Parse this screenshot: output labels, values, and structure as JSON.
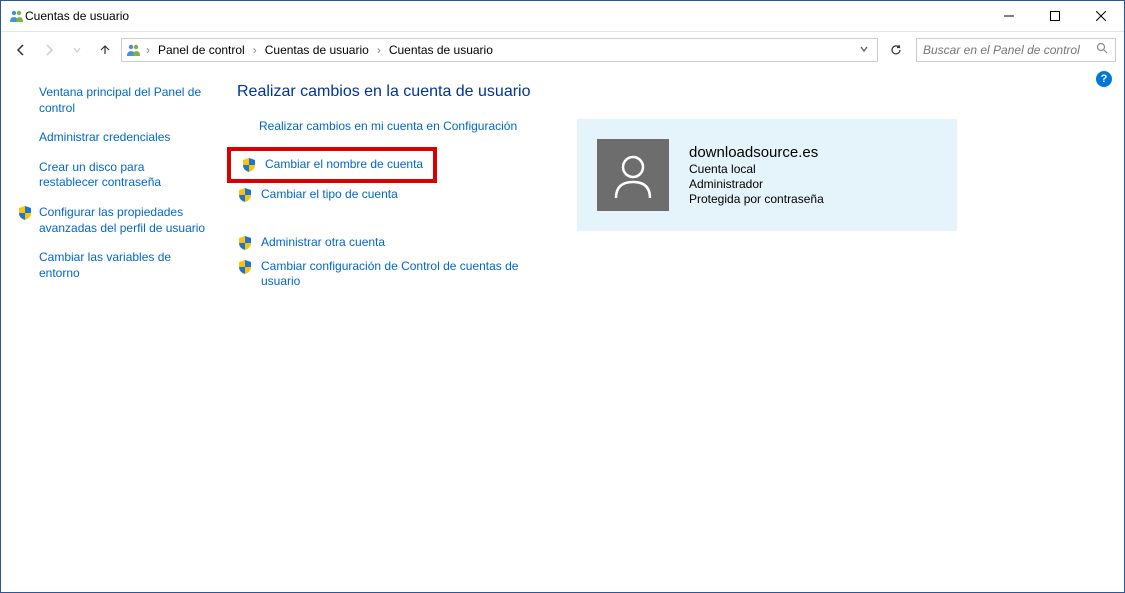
{
  "window": {
    "title": "Cuentas de usuario"
  },
  "breadcrumb": {
    "items": [
      "Panel de control",
      "Cuentas de usuario",
      "Cuentas de usuario"
    ]
  },
  "search": {
    "placeholder": "Buscar en el Panel de control"
  },
  "sidebar": {
    "home": "Ventana principal del Panel de control",
    "creds": "Administrar credenciales",
    "reset_disk": "Crear un disco para restablecer contraseña",
    "advanced": "Configurar las propiedades avanzadas del perfil de usuario",
    "env": "Cambiar las variables de entorno"
  },
  "main": {
    "heading": "Realizar cambios en la cuenta de usuario",
    "config_link": "Realizar cambios en mi cuenta en Configuración",
    "rename": "Cambiar el nombre de cuenta",
    "change_type": "Cambiar el tipo de cuenta",
    "manage_other": "Administrar otra cuenta",
    "uac": "Cambiar configuración de Control de cuentas de usuario"
  },
  "account": {
    "name": "downloadsource.es",
    "type": "Cuenta local",
    "role": "Administrador",
    "protected": "Protegida por contraseña"
  }
}
